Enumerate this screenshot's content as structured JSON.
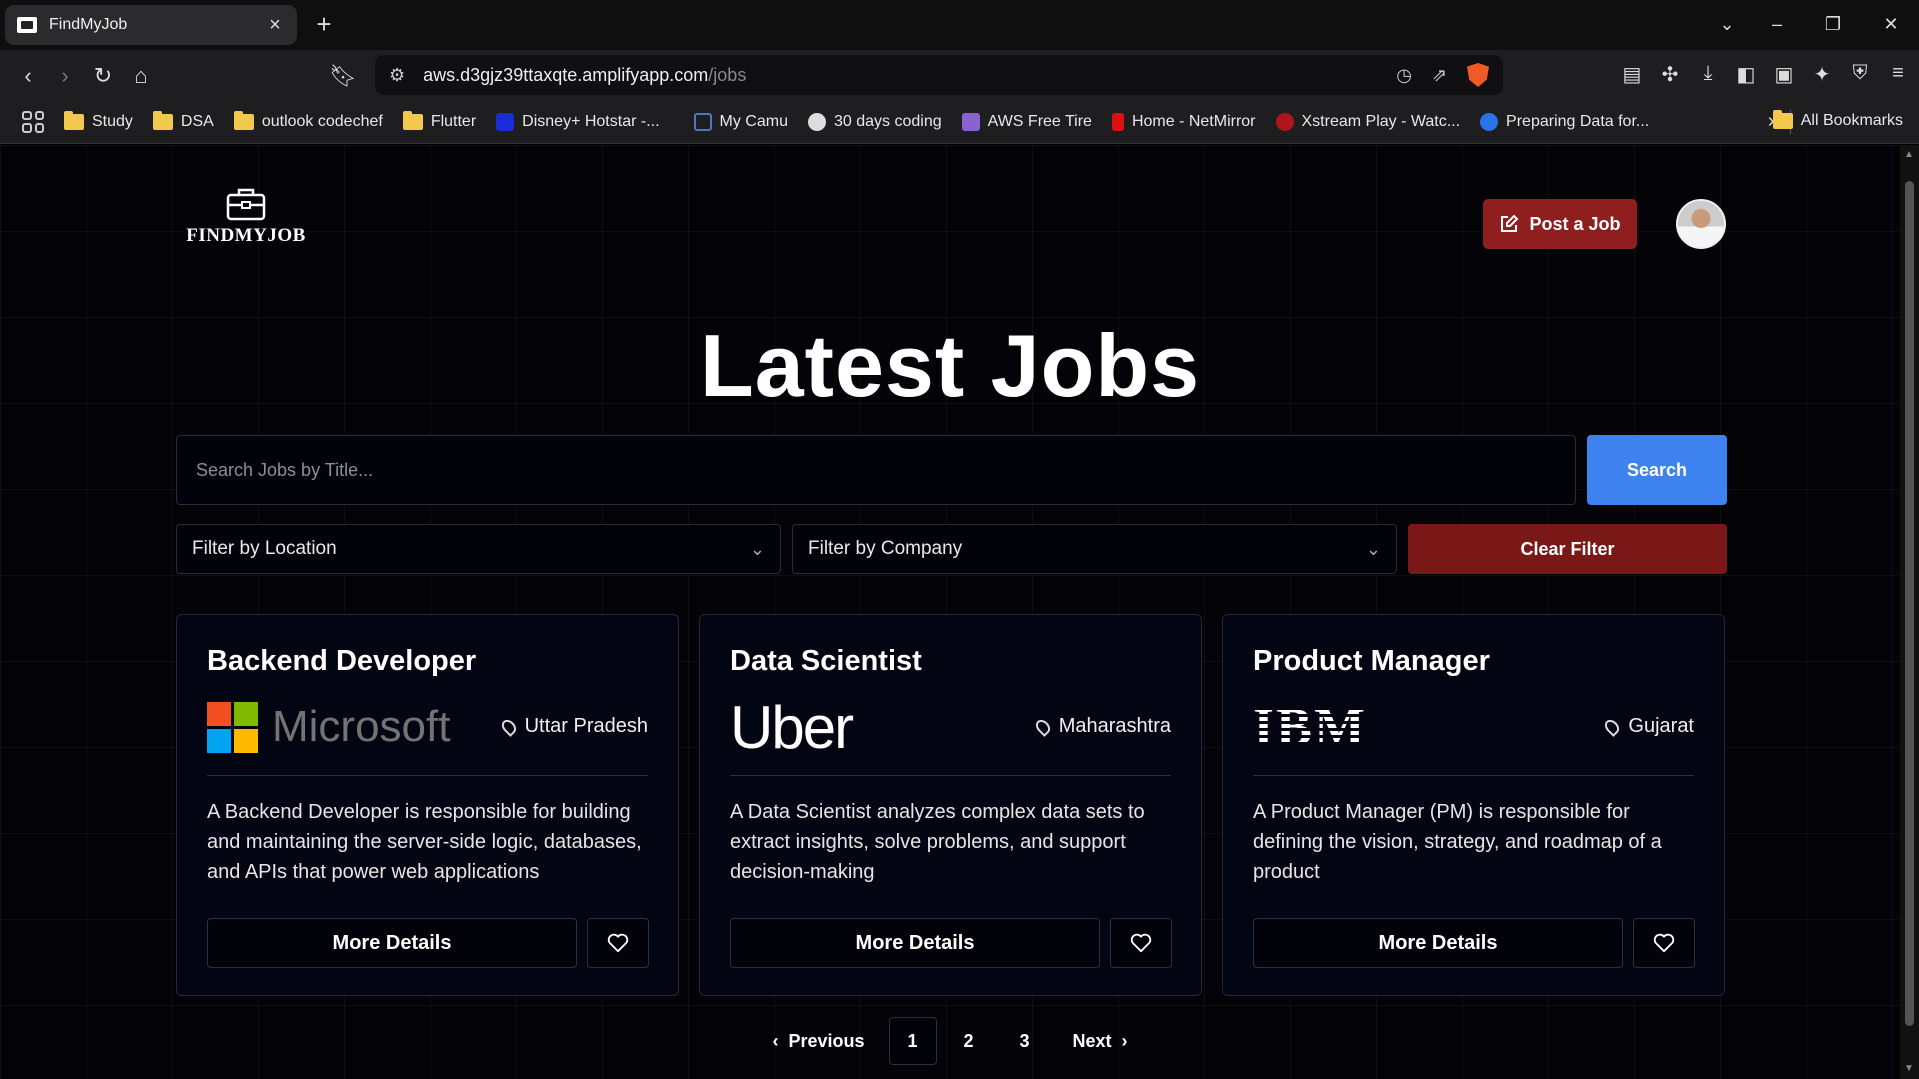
{
  "browser": {
    "tab_title": "FindMyJob",
    "url_host": "aws.d3gjz39ttaxqte.amplifyapp.com",
    "url_path": "/jobs",
    "bookmarks": [
      {
        "label": "Study",
        "icon": "folder-icon"
      },
      {
        "label": "DSA",
        "icon": "folder-icon"
      },
      {
        "label": "outlook codechef",
        "icon": "folder-icon"
      },
      {
        "label": "Flutter",
        "icon": "folder-icon"
      },
      {
        "label": "Disney+ Hotstar -...",
        "icon": "hotstar-icon"
      },
      {
        "label": "My Camu",
        "icon": "camu-icon"
      },
      {
        "label": "30 days coding",
        "icon": "globe-icon"
      },
      {
        "label": "AWS Free Tire",
        "icon": "aws-icon"
      },
      {
        "label": "Home - NetMirror",
        "icon": "netmirror-icon"
      },
      {
        "label": "Xstream Play - Watc...",
        "icon": "xstream-icon"
      },
      {
        "label": "Preparing Data for...",
        "icon": "coursera-icon"
      }
    ],
    "all_bookmarks": "All Bookmarks"
  },
  "header": {
    "logo_text": "FINDMYJOB",
    "post_job_label": "Post a Job"
  },
  "main": {
    "headline": "Latest Jobs",
    "search_placeholder": "Search Jobs by Title...",
    "search_label": "Search",
    "filter_location": "Filter by Location",
    "filter_company": "Filter by Company",
    "clear_filter": "Clear Filter"
  },
  "jobs": [
    {
      "title": "Backend Developer",
      "company": "Microsoft",
      "location": "Uttar Pradesh",
      "description": "A Backend Developer is responsible for building and maintaining the server-side logic, databases, and APIs that power web applications",
      "details_label": "More Details"
    },
    {
      "title": "Data Scientist",
      "company": "Uber",
      "location": "Maharashtra",
      "description": "A Data Scientist analyzes complex data sets to extract insights, solve problems, and support decision-making",
      "details_label": "More Details"
    },
    {
      "title": "Product Manager",
      "company": "IBM",
      "location": "Gujarat",
      "description": "A Product Manager (PM) is responsible for defining the vision, strategy, and roadmap of a product",
      "details_label": "More Details"
    }
  ],
  "pagination": {
    "previous": "Previous",
    "pages": [
      "1",
      "2",
      "3"
    ],
    "current": "1",
    "next": "Next"
  },
  "colors": {
    "accent_blue": "#3d82ee",
    "accent_red": "#8f1e1e",
    "clear_red": "#7a1717",
    "ms_red": "#f25022",
    "ms_green": "#7fba00",
    "ms_blue": "#00a4ef",
    "ms_yellow": "#ffb900"
  }
}
